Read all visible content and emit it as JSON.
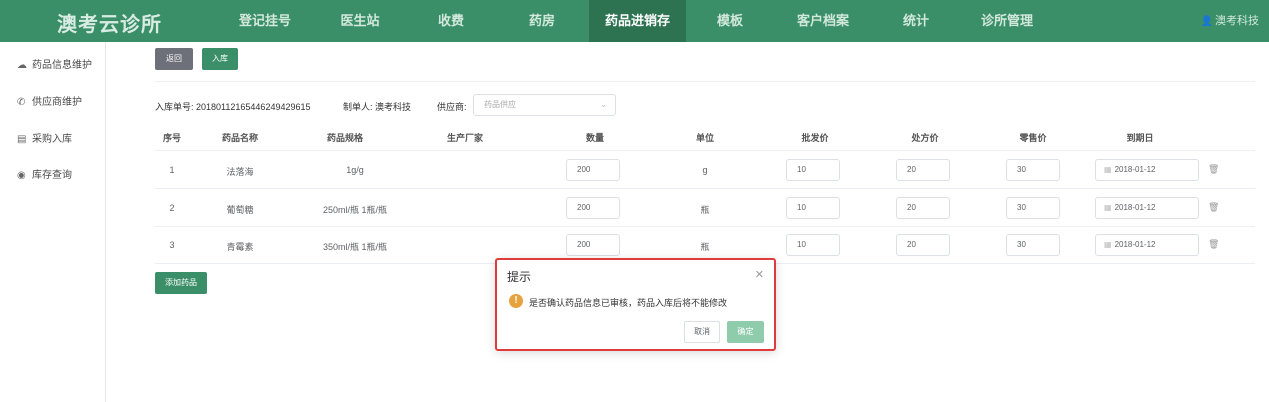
{
  "app": {
    "logo": "澳考云诊所",
    "user": "澳考科技"
  },
  "nav": [
    {
      "label": "登记挂号"
    },
    {
      "label": "医生站"
    },
    {
      "label": "收费"
    },
    {
      "label": "药房"
    },
    {
      "label": "药品进销存"
    },
    {
      "label": "模板"
    },
    {
      "label": "客户档案"
    },
    {
      "label": "统计"
    },
    {
      "label": "诊所管理"
    }
  ],
  "nav_active_index": 4,
  "sidebar": {
    "items": [
      {
        "label": "药品信息维护",
        "icon": "cloud-icon"
      },
      {
        "label": "供应商维护",
        "icon": "phone-icon"
      },
      {
        "label": "采购入库",
        "icon": "bag-icon"
      },
      {
        "label": "库存查询",
        "icon": "location-icon"
      }
    ]
  },
  "toolbar": {
    "back_label": "返回",
    "in_label": "入库"
  },
  "form": {
    "order_label": "入库单号:",
    "order_no": "20180112165446249429615",
    "maker_label": "制单人:",
    "maker": "澳考科技",
    "supplier_label": "供应商:",
    "supplier_placeholder": "药品供应"
  },
  "table": {
    "headers": [
      "序号",
      "药品名称",
      "药品规格",
      "生产厂家",
      "数量",
      "单位",
      "批发价",
      "处方价",
      "零售价",
      "到期日"
    ],
    "rows": [
      {
        "no": "1",
        "name": "法落海",
        "spec": "1g/g",
        "maker": "",
        "qty": "200",
        "unit": "g",
        "wholesale": "10",
        "prescription": "20",
        "retail": "30",
        "expiry": "2018-01-12"
      },
      {
        "no": "2",
        "name": "葡萄糖",
        "spec": "250ml/瓶 1瓶/瓶",
        "maker": "",
        "qty": "200",
        "unit": "瓶",
        "wholesale": "10",
        "prescription": "20",
        "retail": "30",
        "expiry": "2018-01-12"
      },
      {
        "no": "3",
        "name": "青霉素",
        "spec": "350ml/瓶 1瓶/瓶",
        "maker": "",
        "qty": "200",
        "unit": "瓶",
        "wholesale": "10",
        "prescription": "20",
        "retail": "30",
        "expiry": "2018-01-12"
      }
    ]
  },
  "add_drug_label": "添加药品",
  "dialog": {
    "title": "提示",
    "message": "是否确认药品信息已审核，药品入库后将不能修改",
    "cancel_label": "取消",
    "ok_label": "确定",
    "icon": "warning-icon"
  },
  "colors": {
    "brand": "#3a8f68",
    "active_nav": "#2d7352",
    "warning": "#e6a23c",
    "highlight": "#e03b3b"
  }
}
